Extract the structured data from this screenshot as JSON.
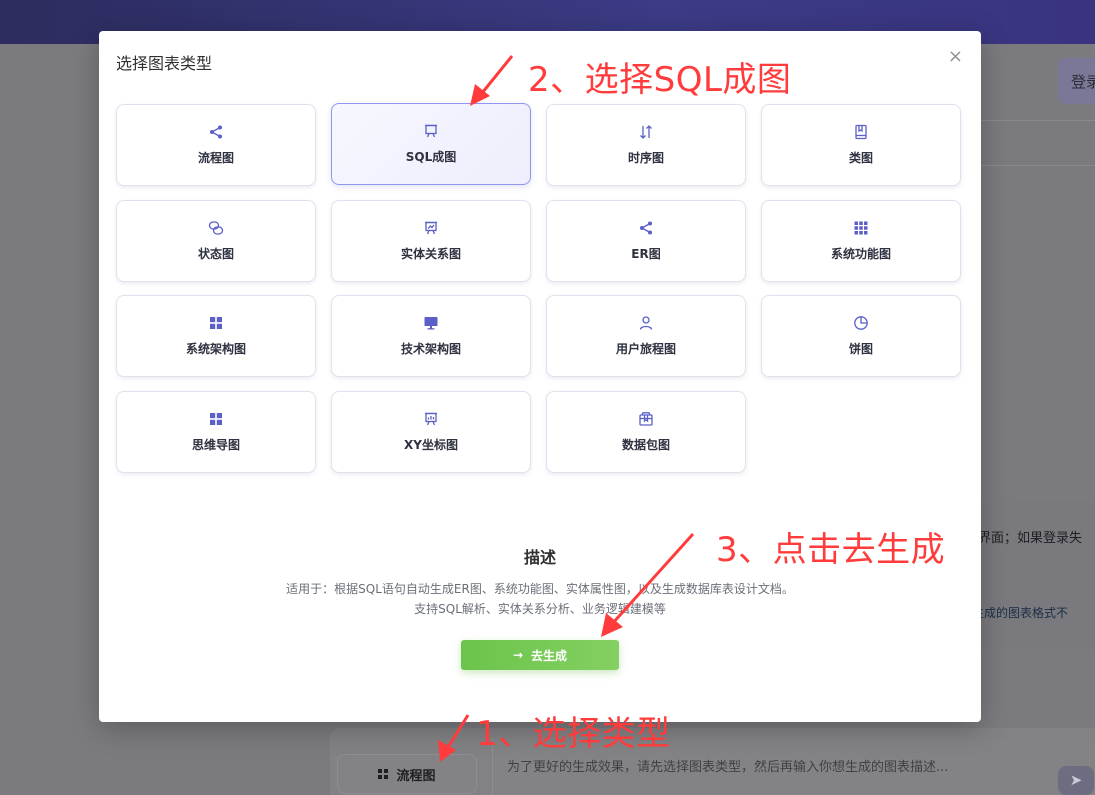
{
  "background": {
    "login_label": "登录",
    "side_text_1": "界面；如果登录失",
    "side_text_2": "生成的图表格式不",
    "type_button_label": "流程图",
    "input_placeholder": "为了更好的生成效果，请先选择图表类型，然后再输入你想生成的图表描述...",
    "send_icon": "send-icon"
  },
  "modal": {
    "title": "选择图表类型",
    "close_label": "×",
    "selected": "SQL成图",
    "cards": [
      {
        "label": "流程图",
        "icon": "share-icon"
      },
      {
        "label": "SQL成图",
        "icon": "presentation-icon"
      },
      {
        "label": "时序图",
        "icon": "sequence-arrows-icon"
      },
      {
        "label": "类图",
        "icon": "book-icon"
      },
      {
        "label": "状态图",
        "icon": "link-circles-icon"
      },
      {
        "label": "实体关系图",
        "icon": "trend-board-icon"
      },
      {
        "label": "ER图",
        "icon": "share-icon"
      },
      {
        "label": "系统功能图",
        "icon": "grid9-icon"
      },
      {
        "label": "系统架构图",
        "icon": "grid4-icon"
      },
      {
        "label": "技术架构图",
        "icon": "monitor-icon"
      },
      {
        "label": "用户旅程图",
        "icon": "user-icon"
      },
      {
        "label": "饼图",
        "icon": "pie-icon"
      },
      {
        "label": "思维导图",
        "icon": "grid4-icon"
      },
      {
        "label": "XY坐标图",
        "icon": "bar-board-icon"
      },
      {
        "label": "数据包图",
        "icon": "package-icon"
      }
    ],
    "description": {
      "title": "描述",
      "line1": "适用于：根据SQL语句自动生成ER图、系统功能图、实体属性图，以及生成数据库表设计文档。",
      "line2": "支持SQL解析、实体关系分析、业务逻辑建模等"
    },
    "generate_button": {
      "label": "去生成",
      "icon": "arrow-right-icon"
    }
  },
  "annotations": {
    "step1": "1、选择类型",
    "step2": "2、选择SQL成图",
    "step3": "3、点击去生成"
  },
  "colors": {
    "accent": "#5b5fc7",
    "annotation": "#ff3b3b",
    "generate_button": "#6bc44a",
    "selected_border": "#8e96ee"
  }
}
